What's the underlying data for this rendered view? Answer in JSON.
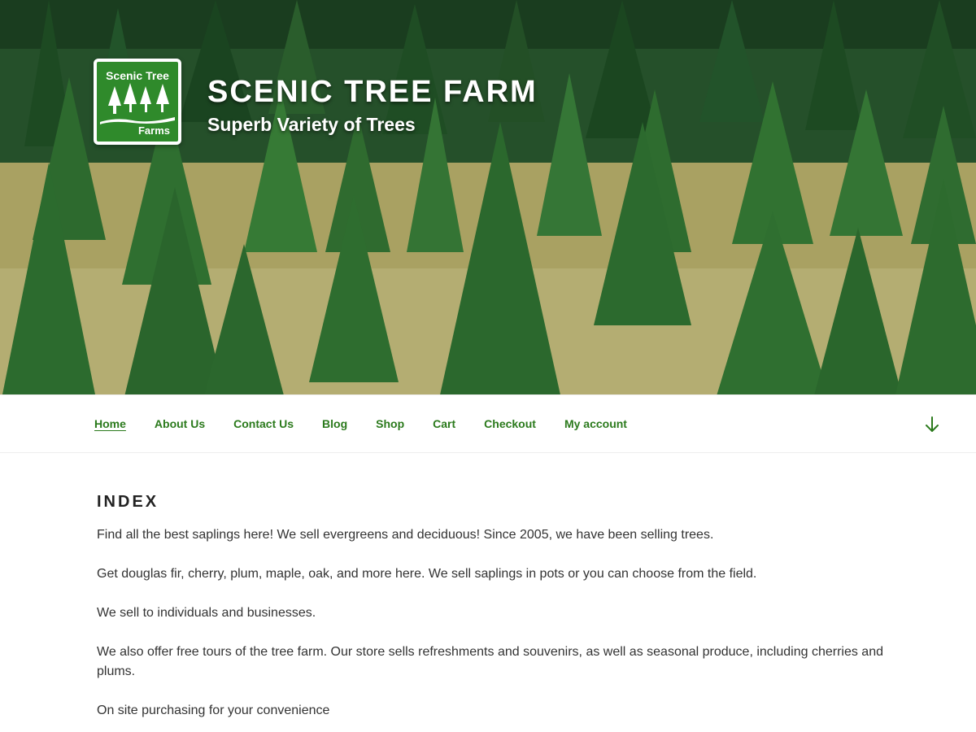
{
  "site": {
    "logo": {
      "line1": "Scenic Tree",
      "line2": "Farms",
      "icon": "tree-logo-icon"
    },
    "title": "Scenic Tree Farm",
    "tagline": "Superb Variety of Trees"
  },
  "nav": {
    "items": [
      {
        "label": "Home",
        "current": true
      },
      {
        "label": "About Us"
      },
      {
        "label": "Contact Us"
      },
      {
        "label": "Blog"
      },
      {
        "label": "Shop"
      },
      {
        "label": "Cart"
      },
      {
        "label": "Checkout"
      },
      {
        "label": "My account"
      }
    ],
    "scroll_icon": "arrow-down-icon"
  },
  "page": {
    "heading": "Index",
    "paragraphs": [
      "Find all the best saplings here! We sell evergreens and deciduous! Since 2005, we have been selling trees.",
      "Get douglas fir, cherry, plum, maple, oak, and more here. We sell saplings in pots or you can choose from the field.",
      "We sell to individuals and businesses.",
      "We also offer free tours of the tree farm. Our store sells refreshments and souvenirs, as well as seasonal produce, including cherries and plums.",
      "On site purchasing for your convenience"
    ]
  },
  "colors": {
    "accent": "#2b7a1c",
    "logo_bg": "#2f8a2b",
    "heading": "#222222",
    "text": "#333333"
  }
}
